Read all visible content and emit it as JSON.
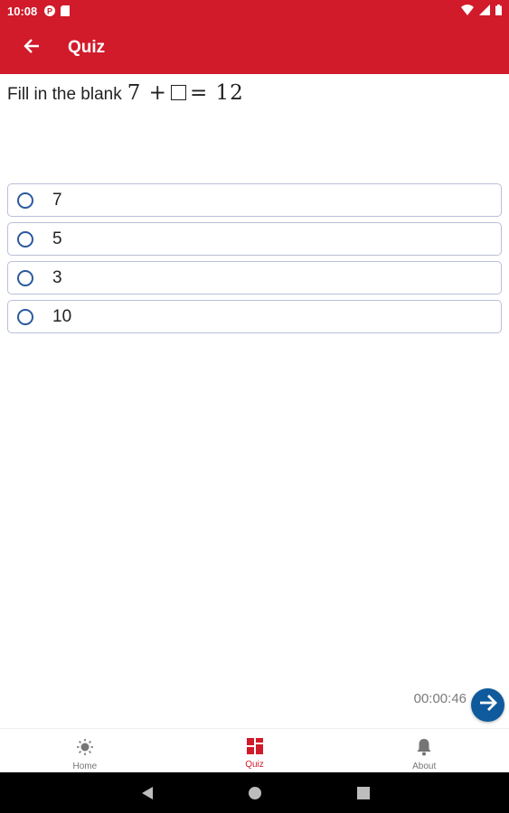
{
  "status_bar": {
    "time": "10:08",
    "icons": [
      "p-icon",
      "sd-card-icon",
      "wifi-icon",
      "signal-icon",
      "battery-icon"
    ]
  },
  "app_bar": {
    "title": "Quiz",
    "back_icon": "arrow-left-icon",
    "color": "#d11a2a"
  },
  "question": {
    "prompt": "Fill in the blank",
    "math_left": "7 +",
    "math_right": "= 12"
  },
  "options": [
    {
      "label": "7",
      "selected": false
    },
    {
      "label": "5",
      "selected": false
    },
    {
      "label": "3",
      "selected": false
    },
    {
      "label": "10",
      "selected": false
    }
  ],
  "timer": "00:00:46",
  "next_button": {
    "icon": "arrow-right-icon",
    "color": "#0f5a9c"
  },
  "bottom_nav": [
    {
      "label": "Home",
      "icon": "sun-icon",
      "active": false
    },
    {
      "label": "Quiz",
      "icon": "grid-icon",
      "active": true
    },
    {
      "label": "About",
      "icon": "bell-icon",
      "active": false
    }
  ],
  "system_nav": [
    "back-triangle-icon",
    "home-circle-icon",
    "recents-square-icon"
  ]
}
